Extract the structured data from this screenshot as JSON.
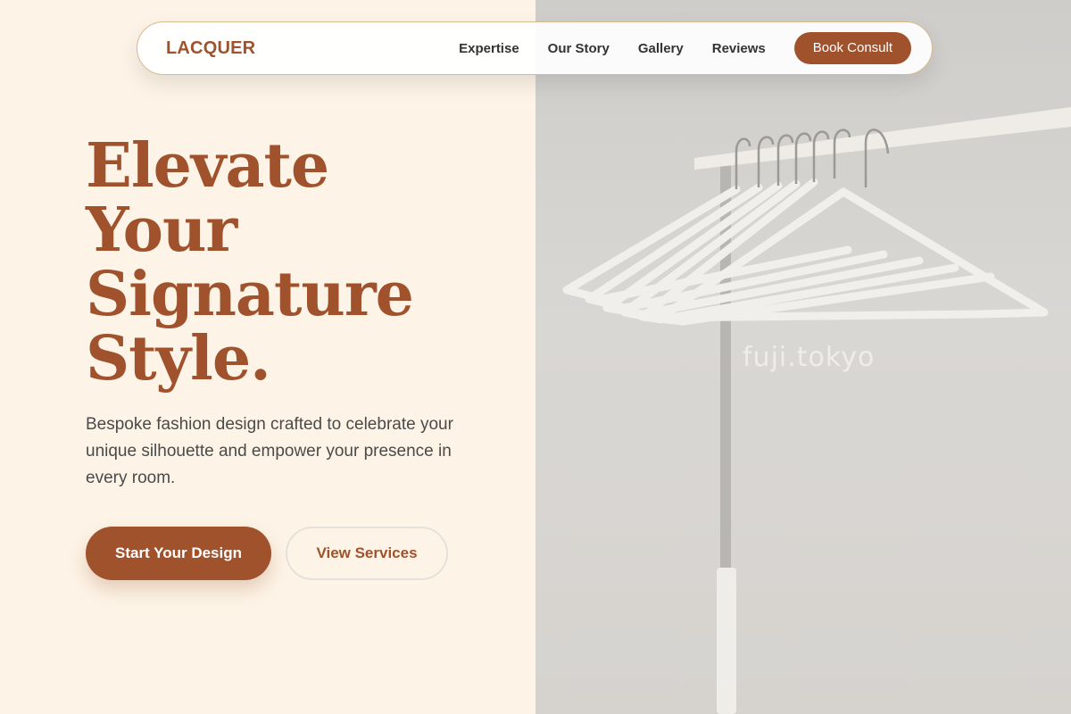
{
  "brand": {
    "logo": "LACQUER"
  },
  "nav": {
    "links": [
      "Expertise",
      "Our Story",
      "Gallery",
      "Reviews"
    ],
    "cta_label": "Book Consult"
  },
  "hero": {
    "title_lines": [
      "Elevate",
      "Your",
      "Signature",
      "Style."
    ],
    "subtitle": "Bespoke fashion design crafted to celebrate your unique silhouette and empower your presence in every room.",
    "primary_cta": "Start Your Design",
    "secondary_cta": "View Services"
  },
  "image": {
    "subject": "white hangers on clothing rack",
    "watermark": "fuji.tokyo"
  },
  "colors": {
    "accent": "#a0522d",
    "background": "#fdf4e7",
    "text": "#4a4a4a"
  }
}
